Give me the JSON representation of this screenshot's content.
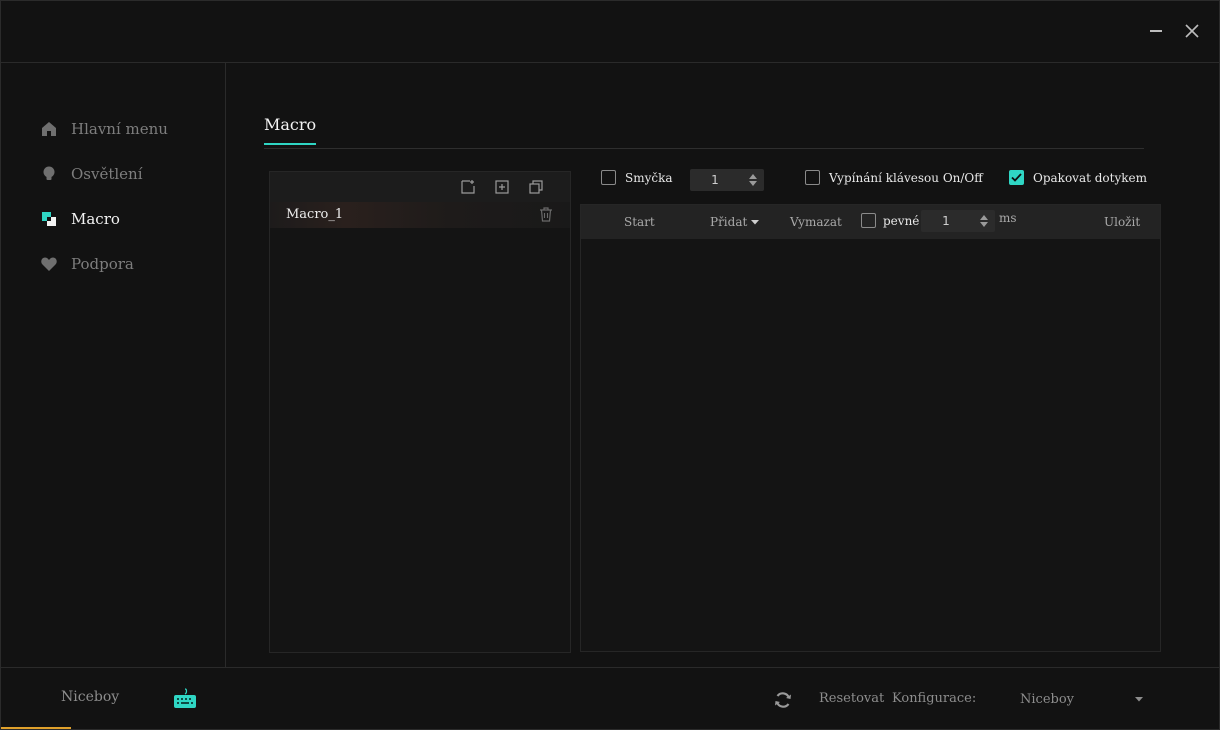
{
  "sidebar": {
    "items": [
      {
        "label": "Hlavní menu",
        "icon": "home-icon",
        "active": false
      },
      {
        "label": "Osvětlení",
        "icon": "bulb-icon",
        "active": false
      },
      {
        "label": "Macro",
        "icon": "macro-icon",
        "active": true
      },
      {
        "label": "Podpora",
        "icon": "heart-icon",
        "active": false
      }
    ]
  },
  "main": {
    "tab": "Macro",
    "macro_list": {
      "toolbar_icons": [
        "new-file-icon",
        "import-icon",
        "copy-icon"
      ],
      "items": [
        {
          "name": "Macro_1"
        }
      ]
    },
    "options": {
      "loop_label": "Smyčka",
      "loop_checked": false,
      "loop_count": "1",
      "key_toggle_label": "Vypínání klávesou On/Off",
      "key_toggle_checked": false,
      "repeat_touch_label": "Opakovat dotykem",
      "repeat_touch_checked": true
    },
    "editor": {
      "start_label": "Start",
      "add_label": "Přidat",
      "clear_label": "Vymazat",
      "fixed_label": "pevné",
      "fixed_checked": false,
      "delay_value": "1",
      "delay_unit": "ms",
      "save_label": "Uložit"
    }
  },
  "bottom": {
    "device_name": "Niceboy",
    "reset_label": "Resetovat",
    "config_label": "Konfigurace:",
    "config_value": "Niceboy"
  },
  "colors": {
    "accent": "#2fd6c4",
    "background": "#121212",
    "panel": "#141414"
  }
}
